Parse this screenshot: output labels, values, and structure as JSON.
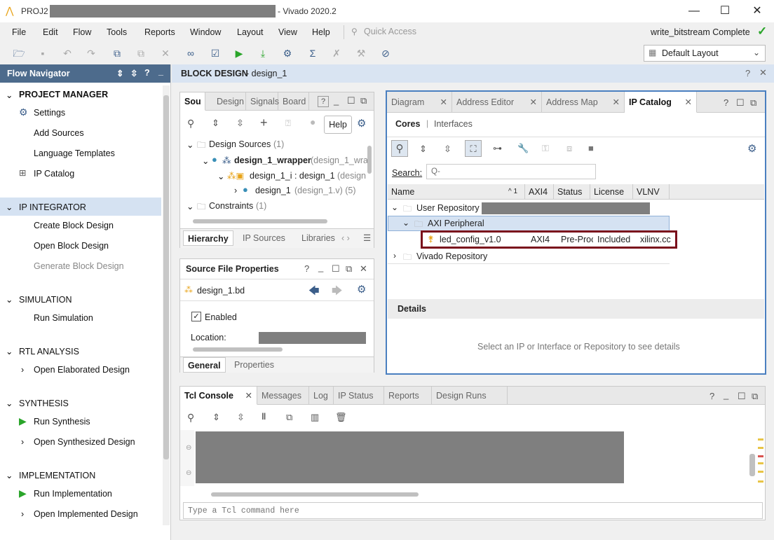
{
  "window": {
    "title_left": "PROJ2 -",
    "title_right": "- Vivado 2020.2",
    "minimize": "—",
    "maximize": "☐",
    "close": "✕"
  },
  "menu": [
    "File",
    "Edit",
    "Flow",
    "Tools",
    "Reports",
    "Window",
    "Layout",
    "View",
    "Help"
  ],
  "quick_access": {
    "placeholder": "Quick Access"
  },
  "status": {
    "text": "write_bitstream Complete",
    "check": "✓"
  },
  "layout_select": {
    "value": "Default Layout"
  },
  "flow_navigator": {
    "title": "Flow Navigator",
    "project_manager": {
      "label": "PROJECT MANAGER",
      "items": [
        "Settings",
        "Add Sources",
        "Language Templates",
        "IP Catalog"
      ]
    },
    "ip_integrator": {
      "label": "IP INTEGRATOR",
      "items": [
        "Create Block Design",
        "Open Block Design",
        "Generate Block Design"
      ]
    },
    "simulation": {
      "label": "SIMULATION",
      "items": [
        "Run Simulation"
      ]
    },
    "rtl_analysis": {
      "label": "RTL ANALYSIS",
      "items": [
        "Open Elaborated Design"
      ]
    },
    "synthesis": {
      "label": "SYNTHESIS",
      "items": [
        "Run Synthesis",
        "Open Synthesized Design"
      ]
    },
    "implementation": {
      "label": "IMPLEMENTATION",
      "items": [
        "Run Implementation",
        "Open Implemented Design"
      ]
    }
  },
  "block_design": {
    "title_bold": "BLOCK DESIGN",
    "title_rest": "- design_1"
  },
  "sources": {
    "tabs": [
      "Sou",
      "Design",
      "Signals",
      "Board"
    ],
    "tooltip": "Help",
    "tree": [
      {
        "label": "Design Sources",
        "count": "(1)"
      },
      {
        "label": "design_1_wrapper",
        "extra": "(design_1_wra"
      },
      {
        "label": "design_1_i : design_1",
        "extra": "(design"
      },
      {
        "label": "design_1",
        "extra": "(design_1.v) (5)"
      },
      {
        "label": "Constraints",
        "count": "(1)"
      }
    ],
    "bottom_tabs": [
      "Hierarchy",
      "IP Sources",
      "Libraries"
    ]
  },
  "sfp": {
    "title": "Source File Properties",
    "file": "design_1.bd",
    "enabled_label": "Enabled",
    "location_label": "Location:",
    "bottom_tabs": [
      "General",
      "Properties"
    ]
  },
  "ip_panel": {
    "tabs": [
      "Diagram",
      "Address Editor",
      "Address Map",
      "IP Catalog"
    ],
    "subtabs": [
      "Cores",
      "Interfaces"
    ],
    "search_label": "Search:",
    "search_placeholder": "Q-",
    "columns": [
      "Name",
      "AXI4",
      "Status",
      "License",
      "VLNV"
    ],
    "sort_indicator": "^ 1",
    "rows": {
      "user_repo": "User Repository",
      "axi_peripheral": "AXI Peripheral",
      "ip": {
        "name": "led_config_v1.0",
        "axi4": "AXI4",
        "status": "Pre-Proc",
        "license": "Included",
        "vlnv": "xilinx.cc"
      },
      "vivado_repo": "Vivado Repository"
    },
    "details_title": "Details",
    "details_msg": "Select an IP or Interface or Repository to see details",
    "highlight_color": "#7a0f1c"
  },
  "console": {
    "tabs": [
      "Tcl Console",
      "Messages",
      "Log",
      "IP Status",
      "Reports",
      "Design Runs"
    ],
    "input_placeholder": "Type a Tcl command here"
  },
  "colors": {
    "accent": "#4d6b8c",
    "selection": "#d5e2f2",
    "green": "#2aa52a"
  }
}
